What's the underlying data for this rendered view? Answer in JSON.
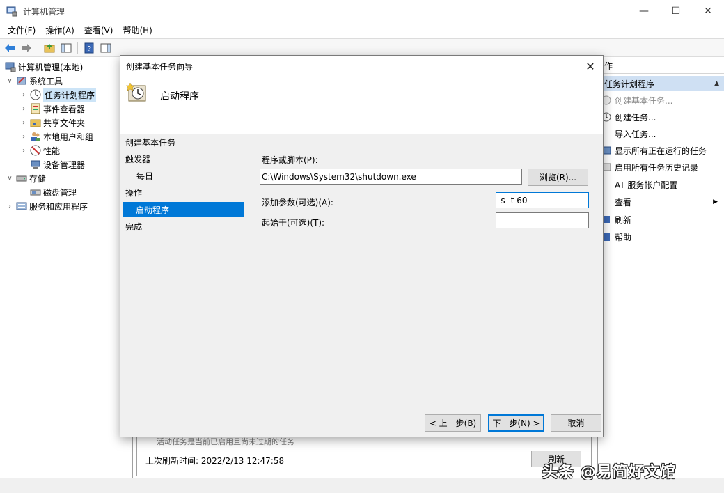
{
  "window": {
    "title": "计算机管理",
    "controls": {
      "minimize": "—",
      "maximize": "☐",
      "close": "✕"
    }
  },
  "menu": [
    "文件(F)",
    "操作(A)",
    "查看(V)",
    "帮助(H)"
  ],
  "tree": {
    "root": "计算机管理(本地)",
    "system_tools": "系统工具",
    "task_scheduler": "任务计划程序",
    "event_viewer": "事件查看器",
    "shared_folders": "共享文件夹",
    "local_users": "本地用户和组",
    "performance": "性能",
    "device_manager": "设备管理器",
    "storage": "存储",
    "disk_management": "磁盘管理",
    "services_apps": "服务和应用程序"
  },
  "center": {
    "faint_text": "活动任务是当前已启用且尚未过期的任务",
    "last_refresh": "上次刷新时间: 2022/2/13 12:47:58",
    "refresh_button": "刷新"
  },
  "actions": {
    "header": "作",
    "section": "任务计划程序",
    "items": [
      {
        "label": "创建基本任务...",
        "disabled": true
      },
      {
        "label": "创建任务..."
      },
      {
        "label": "导入任务..."
      },
      {
        "label": "显示所有正在运行的任务"
      },
      {
        "label": "启用所有任务历史记录"
      },
      {
        "label": "AT 服务帐户配置"
      },
      {
        "label": "查看"
      },
      {
        "label": "刷新"
      },
      {
        "label": "帮助"
      }
    ]
  },
  "dialog": {
    "title": "创建基本任务向导",
    "close": "✕",
    "header_title": "启动程序",
    "steps": {
      "create": "创建基本任务",
      "trigger": "触发器",
      "daily": "每日",
      "action": "操作",
      "start_program": "启动程序",
      "finish": "完成"
    },
    "program_label": "程序或脚本(P):",
    "program_value": "C:\\Windows\\System32\\shutdown.exe",
    "browse_button": "浏览(R)...",
    "args_label": "添加参数(可选)(A):",
    "args_value": "-s -t 60",
    "start_in_label": "起始于(可选)(T):",
    "start_in_value": "",
    "back_button": "< 上一步(B)",
    "next_button": "下一步(N) >",
    "cancel_button": "取消"
  },
  "watermark": "头条 @易简好文馆",
  "colors": {
    "accent": "#0078d7",
    "selection": "#cce4f7",
    "section_bg": "#cfe0f3"
  }
}
